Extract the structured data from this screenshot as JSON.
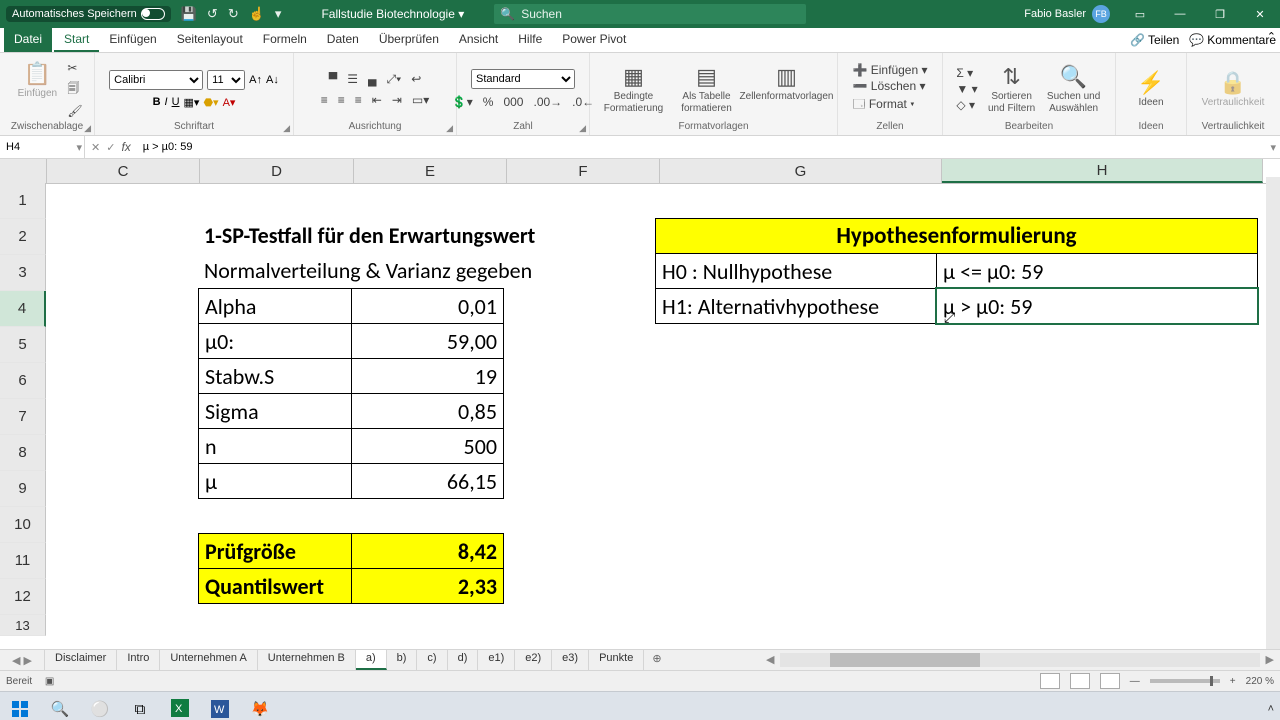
{
  "titlebar": {
    "autosave_label": "Automatisches Speichern",
    "doc_title": "Fallstudie Biotechnologie",
    "search_placeholder": "Suchen",
    "user_name": "Fabio Basler",
    "user_initials": "FB"
  },
  "ribbon": {
    "tabs": [
      "Datei",
      "Start",
      "Einfügen",
      "Seitenlayout",
      "Formeln",
      "Daten",
      "Überprüfen",
      "Ansicht",
      "Hilfe",
      "Power Pivot"
    ],
    "active_tab": "Start",
    "share": "Teilen",
    "comments": "Kommentare",
    "clipboard": {
      "group_label": "Zwischenablage",
      "paste": "Einfügen"
    },
    "font": {
      "group_label": "Schriftart",
      "name": "Calibri",
      "size": "11"
    },
    "align": {
      "group_label": "Ausrichtung"
    },
    "number": {
      "group_label": "Zahl",
      "format": "Standard"
    },
    "styles": {
      "group_label": "Formatvorlagen",
      "cond": "Bedingte Formatierung",
      "table": "Als Tabelle formatieren",
      "cell_styles": "Zellenformatvorlagen"
    },
    "cells": {
      "group_label": "Zellen",
      "insert": "Einfügen",
      "delete": "Löschen",
      "format": "Format"
    },
    "editing": {
      "group_label": "Bearbeiten",
      "sort": "Sortieren und Filtern",
      "find": "Suchen und Auswählen"
    },
    "ideas": {
      "group_label": "Ideen",
      "btn": "Ideen"
    },
    "sensitivity": {
      "group_label": "Vertraulichkeit",
      "btn": "Vertraulichkeit"
    }
  },
  "formula_bar": {
    "name_box": "H4",
    "formula": "µ > µ0: 59"
  },
  "grid": {
    "columns": [
      "C",
      "D",
      "E",
      "F",
      "G",
      "H"
    ],
    "rows": [
      "1",
      "2",
      "3",
      "4",
      "5",
      "6",
      "7",
      "8",
      "9",
      "10",
      "11",
      "12",
      "13"
    ],
    "selected_col": "H",
    "selected_row": "4"
  },
  "sheet": {
    "d2": "1-SP-Testfall für den Erwartungswert",
    "d3": "Normalverteilung & Varianz gegeben",
    "g2": "Hypothesenformulierung",
    "d4": "Alpha",
    "e4": "0,01",
    "d5": "µ0:",
    "e5": "59,00",
    "d6": "Stabw.S",
    "e6": "19",
    "d7": "Sigma",
    "e7": "0,85",
    "d8": "n",
    "e8": "500",
    "d9": "µ",
    "e9": "66,15",
    "d11": "Prüfgröße",
    "e11": "8,42",
    "d12": "Quantilswert",
    "e12": "2,33",
    "g3": "H0 : Nullhypothese",
    "g4": "H1: Alternativhypothese",
    "h3": "µ <= µ0: 59",
    "h4": "µ > µ0: 59"
  },
  "sheet_tabs": [
    "Disclaimer",
    "Intro",
    "Unternehmen A",
    "Unternehmen B",
    "a)",
    "b)",
    "c)",
    "d)",
    "e1)",
    "e2)",
    "e3)",
    "Punkte"
  ],
  "active_sheet": "a)",
  "statusbar": {
    "ready": "Bereit",
    "zoom": "220 %"
  }
}
